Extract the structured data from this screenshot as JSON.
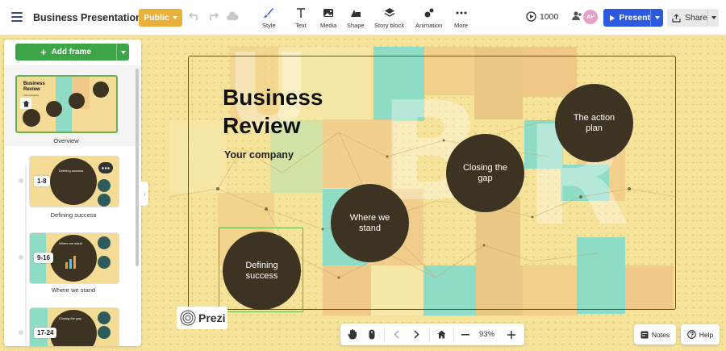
{
  "app": {
    "title": "Business Presentation",
    "public_label": "Public",
    "credits": "1000",
    "avatar_initials": "AP",
    "present_label": "Present",
    "share_label": "Share"
  },
  "toolbar": {
    "items": [
      {
        "label": "Style",
        "icon": "brush-icon"
      },
      {
        "label": "Text",
        "icon": "text-icon"
      },
      {
        "label": "Media",
        "icon": "image-icon"
      },
      {
        "label": "Shape",
        "icon": "shape-icon"
      },
      {
        "label": "Story block",
        "icon": "layers-icon"
      },
      {
        "label": "Animation",
        "icon": "animation-icon"
      },
      {
        "label": "More",
        "icon": "more-icon"
      }
    ]
  },
  "sidebar": {
    "add_frame_label": "Add frame",
    "overview_label": "Overview",
    "frames": [
      {
        "range": "1-8",
        "label": "Defining success",
        "thumb_title": "Defining success"
      },
      {
        "range": "9-16",
        "label": "Where we stand",
        "thumb_title": "Where we stand"
      },
      {
        "range": "17-24",
        "label": "",
        "thumb_title": "Closing the gap"
      }
    ],
    "overview_thumb": {
      "title": "Business\nReview",
      "sub": "Your company"
    }
  },
  "canvas": {
    "title_line1": "Business",
    "title_line2": "Review",
    "subtitle": "Your company",
    "topics": [
      {
        "name": "Defining\nsuccess"
      },
      {
        "name": "Where we\nstand"
      },
      {
        "name": "Closing the\ngap"
      },
      {
        "name": "The action\nplan"
      }
    ]
  },
  "controls": {
    "zoom": "93%",
    "notes_label": "Notes",
    "help_label": "Help",
    "logo_text": "Prezi"
  },
  "colors": {
    "accent_present": "#2b59e0",
    "public_badge": "#e8b23a",
    "add_frame": "#3ca548",
    "topic_circle": "#3d3322",
    "canvas_bg": "#f6e39a",
    "tile_teal": "#8fdcc6",
    "tile_orange": "#f0c988"
  }
}
